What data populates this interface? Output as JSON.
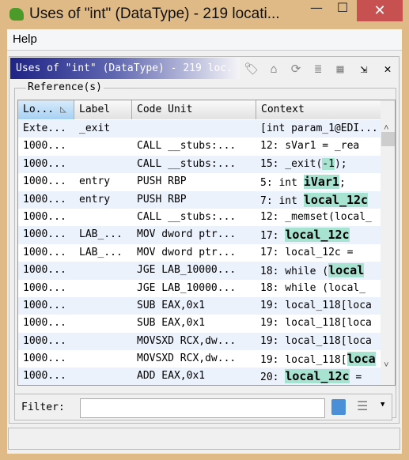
{
  "window": {
    "title": "Uses of \"int\" (DataType) - 219 locati...",
    "minimize": "—",
    "maximize": "☐",
    "close": "✕"
  },
  "menu": {
    "help": "Help"
  },
  "panel": {
    "title": "Uses of \"int\" (DataType) - 219 loc.",
    "tools": [
      {
        "name": "tag-icon",
        "glyph": "🏷"
      },
      {
        "name": "home-icon",
        "glyph": "⌂"
      },
      {
        "name": "refresh-icon",
        "glyph": "⟳"
      },
      {
        "name": "lines-icon",
        "glyph": "≣"
      },
      {
        "name": "table-icon",
        "glyph": "▦"
      },
      {
        "name": "export-icon",
        "glyph": "⇲"
      },
      {
        "name": "close-icon",
        "glyph": "✕"
      }
    ]
  },
  "group": {
    "label": "Reference(s)"
  },
  "columns": [
    "Lo...",
    "Label",
    "Code Unit",
    "Context"
  ],
  "rows": [
    {
      "loc": "Exte...",
      "label": "_exit",
      "code": "",
      "ctx": [
        "[int param_1@EDI...",
        "",
        ""
      ]
    },
    {
      "loc": "1000...",
      "label": "",
      "code": "CALL __stubs:...",
      "ctx": [
        "12:  sVar1  =  _rea",
        "",
        ""
      ]
    },
    {
      "loc": "1000...",
      "label": "",
      "code": "CALL __stubs:...",
      "ctx": [
        "15:  _exit(",
        "-1",
        ");"
      ]
    },
    {
      "loc": "1000...",
      "label": "entry",
      "code": "PUSH RBP",
      "ctx": [
        "5:  int  ",
        "iVar1",
        ";"
      ]
    },
    {
      "loc": "1000...",
      "label": "entry",
      "code": "PUSH RBP",
      "ctx": [
        "7:  int  ",
        "local_12c",
        ""
      ]
    },
    {
      "loc": "1000...",
      "label": "",
      "code": "CALL __stubs:...",
      "ctx": [
        "12:  _memset(local_",
        "",
        ""
      ]
    },
    {
      "loc": "1000...",
      "label": "LAB_...",
      "code": "MOV dword ptr...",
      "ctx": [
        "17:  ",
        "local_12c",
        ""
      ]
    },
    {
      "loc": "1000...",
      "label": "LAB_...",
      "code": "MOV dword ptr...",
      "ctx": [
        "17:  local_12c  =",
        "",
        ""
      ]
    },
    {
      "loc": "1000...",
      "label": "",
      "code": "JGE LAB_10000...",
      "ctx": [
        "18:  while  (",
        "local",
        ""
      ]
    },
    {
      "loc": "1000...",
      "label": "",
      "code": "JGE LAB_10000...",
      "ctx": [
        "18:  while  (local_",
        "",
        ""
      ]
    },
    {
      "loc": "1000...",
      "label": "",
      "code": "SUB EAX,0x1",
      "ctx": [
        "19:  local_118[loca",
        "",
        ""
      ]
    },
    {
      "loc": "1000...",
      "label": "",
      "code": "SUB EAX,0x1",
      "ctx": [
        "19:  local_118[loca",
        "",
        ""
      ]
    },
    {
      "loc": "1000...",
      "label": "",
      "code": "MOVSXD RCX,dw...",
      "ctx": [
        "19:  local_118[loca",
        "",
        ""
      ]
    },
    {
      "loc": "1000...",
      "label": "",
      "code": "MOVSXD RCX,dw...",
      "ctx": [
        "19:  local_118[",
        "loca",
        ""
      ]
    },
    {
      "loc": "1000...",
      "label": "",
      "code": "ADD EAX,0x1",
      "ctx": [
        "20:  ",
        "local_12c",
        "  ="
      ]
    }
  ],
  "filter": {
    "label": "Filter:",
    "value": ""
  },
  "colors": {
    "highlight": "#a8e2d0",
    "title_gradient_start": "#1e2385"
  }
}
